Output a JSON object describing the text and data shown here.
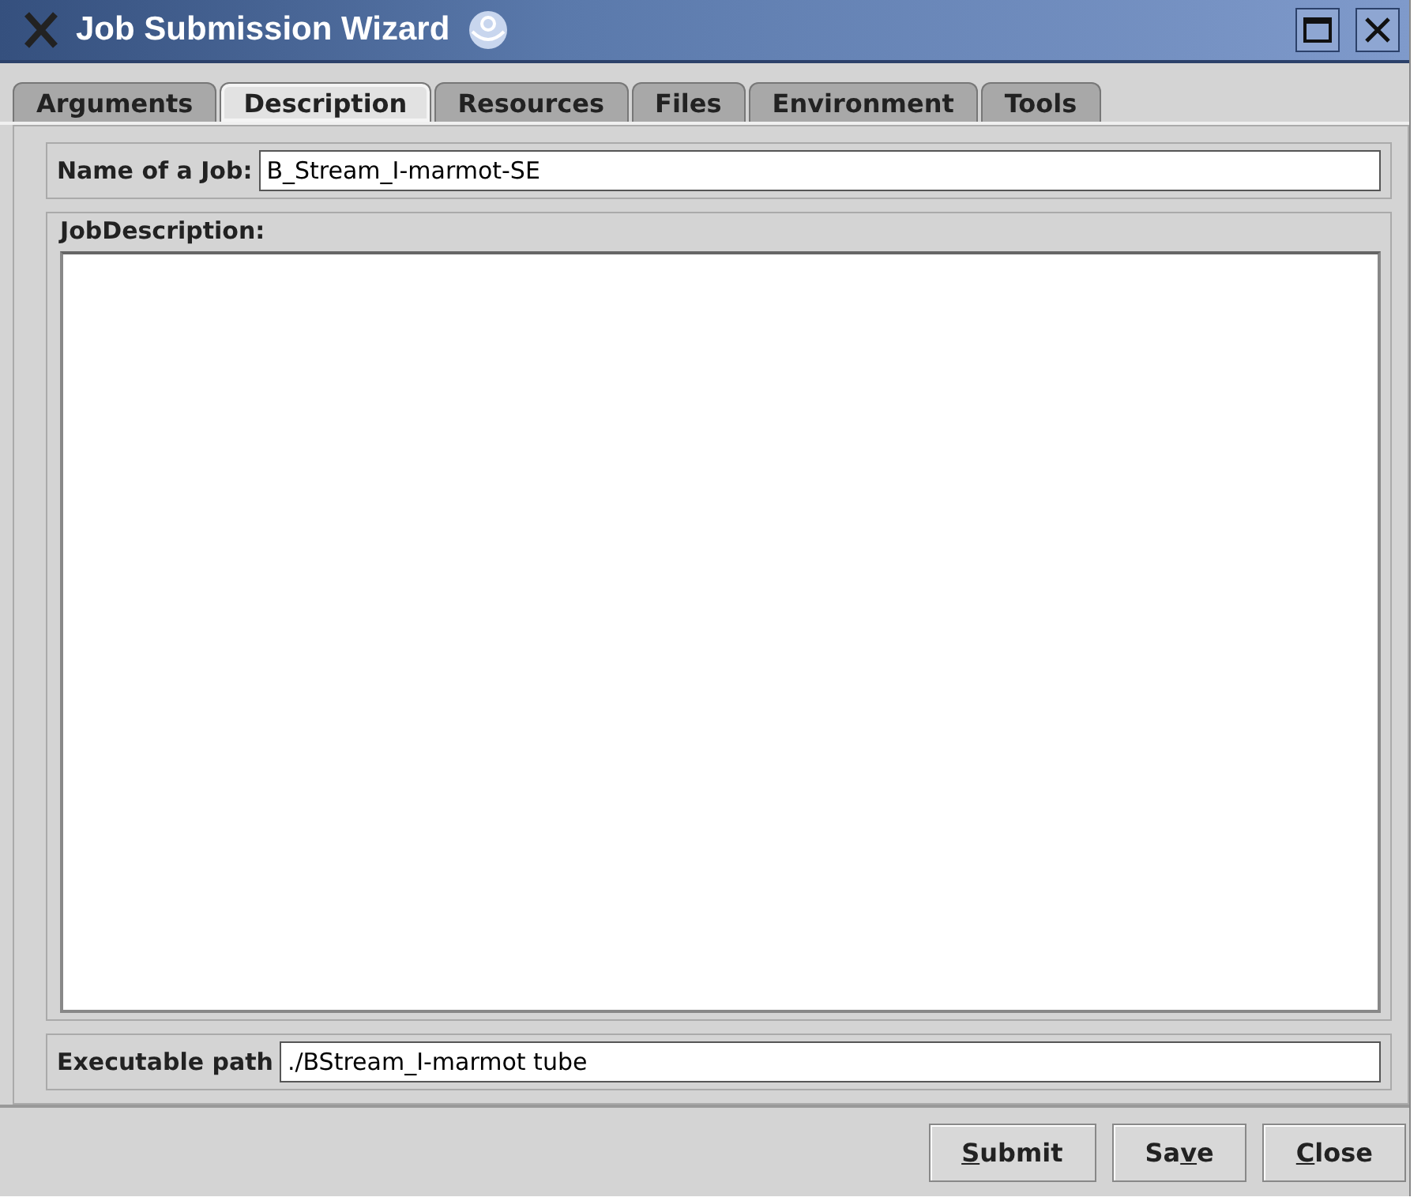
{
  "window": {
    "title": "Job Submission Wizard"
  },
  "tabs": [
    {
      "label": "Arguments",
      "selected": false
    },
    {
      "label": "Description",
      "selected": true
    },
    {
      "label": "Resources",
      "selected": false
    },
    {
      "label": "Files",
      "selected": false
    },
    {
      "label": "Environment",
      "selected": false
    },
    {
      "label": "Tools",
      "selected": false
    }
  ],
  "job_name": {
    "label": "Name of a Job:",
    "value": "B_Stream_I-marmot-SE"
  },
  "job_description": {
    "label": "JobDescription:"
  },
  "executable_path": {
    "label": "Executable path",
    "value": "./BStream_I-marmot tube"
  },
  "buttons": [
    {
      "key": "S",
      "after": "ubmit"
    },
    {
      "before": "Sa",
      "key": "v",
      "after": "e"
    },
    {
      "key": "C",
      "after": "lose"
    }
  ]
}
